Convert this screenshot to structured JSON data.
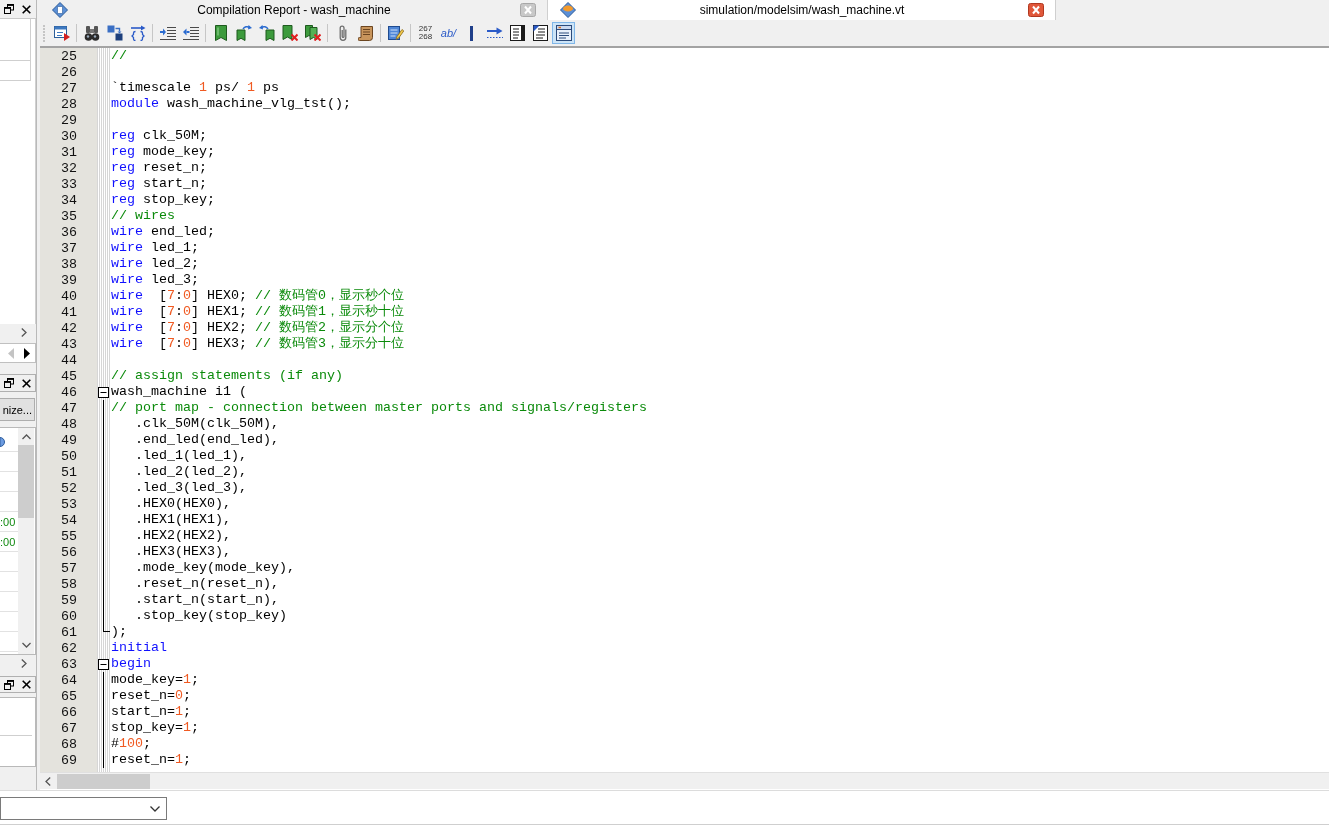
{
  "left_panel": {
    "navigator": [
      {
        "kind": "back",
        "disabled": true
      },
      {
        "kind": "forward",
        "disabled": false
      }
    ],
    "button": {
      "label": "nize..."
    },
    "table_rows": [
      {
        "kind": "icon"
      },
      {
        "kind": "blank"
      },
      {
        "kind": "blank"
      },
      {
        "kind": "blank"
      },
      {
        "kind": "time",
        "text": ":00"
      },
      {
        "kind": "time",
        "text": ":00"
      },
      {
        "kind": "blank"
      },
      {
        "kind": "blank"
      },
      {
        "kind": "blank"
      },
      {
        "kind": "blank"
      },
      {
        "kind": "blank"
      }
    ]
  },
  "tabs": [
    {
      "kind": "report",
      "title": "Compilation Report - wash_machine",
      "selected": false
    },
    {
      "kind": "source",
      "title": "simulation/modelsim/wash_machine.vt",
      "selected": true
    }
  ],
  "toolbar": [
    {
      "buttons": [
        {
          "kind": "report",
          "selected": false
        }
      ]
    },
    {
      "buttons": [
        {
          "kind": "find",
          "selected": false
        },
        {
          "kind": "replace",
          "selected": false
        },
        {
          "kind": "braces",
          "selected": false
        }
      ]
    },
    {
      "buttons": [
        {
          "kind": "indent",
          "selected": false
        },
        {
          "kind": "outdent",
          "selected": false
        }
      ]
    },
    {
      "buttons": [
        {
          "kind": "bookmark",
          "selected": false
        },
        {
          "kind": "nextmark",
          "selected": false
        },
        {
          "kind": "prevmark",
          "selected": false
        },
        {
          "kind": "unmark",
          "selected": false
        },
        {
          "kind": "unmarkall",
          "selected": false
        }
      ]
    },
    {
      "buttons": [
        {
          "kind": "attach",
          "selected": false
        },
        {
          "kind": "scroll",
          "selected": false
        }
      ]
    },
    {
      "buttons": [
        {
          "kind": "edit",
          "selected": false
        }
      ]
    },
    {
      "buttons": [
        {
          "kind": "numbers",
          "lines": [
            "267",
            "268"
          ],
          "selected": false
        },
        {
          "kind": "label",
          "text": "ab/",
          "selected": false
        },
        {
          "kind": "bar",
          "selected": false
        },
        {
          "kind": "arrow",
          "selected": false
        },
        {
          "kind": "doc",
          "selected": false
        },
        {
          "kind": "docmark",
          "selected": false
        },
        {
          "kind": "panel",
          "selected": true
        }
      ]
    }
  ],
  "editor": {
    "lines": [
      {
        "number": "25",
        "tokens": [
          {
            "kind": "comment",
            "text": "//"
          }
        ]
      },
      {
        "number": "26"
      },
      {
        "number": "27",
        "tokens": [
          {
            "kind": "plain",
            "text": "`timescale "
          },
          {
            "kind": "number",
            "text": "1"
          },
          {
            "kind": "plain",
            "text": " ps/ "
          },
          {
            "kind": "number",
            "text": "1"
          },
          {
            "kind": "plain",
            "text": " ps"
          }
        ]
      },
      {
        "number": "28",
        "tokens": [
          {
            "kind": "keyword",
            "text": "module"
          },
          {
            "kind": "plain",
            "text": " wash_machine_vlg_tst();"
          }
        ]
      },
      {
        "number": "29"
      },
      {
        "number": "30",
        "tokens": [
          {
            "kind": "keyword",
            "text": "reg"
          },
          {
            "kind": "plain",
            "text": " clk_50M;"
          }
        ]
      },
      {
        "number": "31",
        "tokens": [
          {
            "kind": "keyword",
            "text": "reg"
          },
          {
            "kind": "plain",
            "text": " mode_key;"
          }
        ]
      },
      {
        "number": "32",
        "tokens": [
          {
            "kind": "keyword",
            "text": "reg"
          },
          {
            "kind": "plain",
            "text": " reset_n;"
          }
        ]
      },
      {
        "number": "33",
        "tokens": [
          {
            "kind": "keyword",
            "text": "reg"
          },
          {
            "kind": "plain",
            "text": " start_n;"
          }
        ]
      },
      {
        "number": "34",
        "tokens": [
          {
            "kind": "keyword",
            "text": "reg"
          },
          {
            "kind": "plain",
            "text": " stop_key;"
          }
        ]
      },
      {
        "number": "35",
        "tokens": [
          {
            "kind": "comment",
            "text": "// wires"
          }
        ]
      },
      {
        "number": "36",
        "tokens": [
          {
            "kind": "keyword",
            "text": "wire"
          },
          {
            "kind": "plain",
            "text": " end_led;"
          }
        ]
      },
      {
        "number": "37",
        "tokens": [
          {
            "kind": "keyword",
            "text": "wire"
          },
          {
            "kind": "plain",
            "text": " led_1;"
          }
        ]
      },
      {
        "number": "38",
        "tokens": [
          {
            "kind": "keyword",
            "text": "wire"
          },
          {
            "kind": "plain",
            "text": " led_2;"
          }
        ]
      },
      {
        "number": "39",
        "tokens": [
          {
            "kind": "keyword",
            "text": "wire"
          },
          {
            "kind": "plain",
            "text": " led_3;"
          }
        ]
      },
      {
        "number": "40",
        "tokens": [
          {
            "kind": "keyword",
            "text": "wire"
          },
          {
            "kind": "plain",
            "text": "  ["
          },
          {
            "kind": "number",
            "text": "7"
          },
          {
            "kind": "plain",
            "text": ":"
          },
          {
            "kind": "number",
            "text": "0"
          },
          {
            "kind": "plain",
            "text": "] HEX0; "
          },
          {
            "kind": "comment",
            "text": "// 数码管0，显示秒个位"
          }
        ]
      },
      {
        "number": "41",
        "tokens": [
          {
            "kind": "keyword",
            "text": "wire"
          },
          {
            "kind": "plain",
            "text": "  ["
          },
          {
            "kind": "number",
            "text": "7"
          },
          {
            "kind": "plain",
            "text": ":"
          },
          {
            "kind": "number",
            "text": "0"
          },
          {
            "kind": "plain",
            "text": "] HEX1; "
          },
          {
            "kind": "comment",
            "text": "// 数码管1，显示秒十位"
          }
        ]
      },
      {
        "number": "42",
        "tokens": [
          {
            "kind": "keyword",
            "text": "wire"
          },
          {
            "kind": "plain",
            "text": "  ["
          },
          {
            "kind": "number",
            "text": "7"
          },
          {
            "kind": "plain",
            "text": ":"
          },
          {
            "kind": "number",
            "text": "0"
          },
          {
            "kind": "plain",
            "text": "] HEX2; "
          },
          {
            "kind": "comment",
            "text": "// 数码管2，显示分个位"
          }
        ]
      },
      {
        "number": "43",
        "tokens": [
          {
            "kind": "keyword",
            "text": "wire"
          },
          {
            "kind": "plain",
            "text": "  ["
          },
          {
            "kind": "number",
            "text": "7"
          },
          {
            "kind": "plain",
            "text": ":"
          },
          {
            "kind": "number",
            "text": "0"
          },
          {
            "kind": "plain",
            "text": "] HEX3; "
          },
          {
            "kind": "comment",
            "text": "// 数码管3，显示分十位"
          }
        ]
      },
      {
        "number": "44"
      },
      {
        "number": "45",
        "tokens": [
          {
            "kind": "comment",
            "text": "// assign statements (if any)"
          }
        ]
      },
      {
        "number": "46",
        "tokens": [
          {
            "kind": "plain",
            "text": "wash_machine i1 ("
          }
        ],
        "expanded": true,
        "block_end_visible": true,
        "children": [
          {
            "number": "47",
            "tokens": [
              {
                "kind": "comment",
                "text": "// port map - connection between master ports and signals/registers"
              }
            ]
          },
          {
            "number": "48",
            "tokens": [
              {
                "kind": "plain",
                "text": "   .clk_50M(clk_50M),"
              }
            ]
          },
          {
            "number": "49",
            "tokens": [
              {
                "kind": "plain",
                "text": "   .end_led(end_led),"
              }
            ]
          },
          {
            "number": "50",
            "tokens": [
              {
                "kind": "plain",
                "text": "   .led_1(led_1),"
              }
            ]
          },
          {
            "number": "51",
            "tokens": [
              {
                "kind": "plain",
                "text": "   .led_2(led_2),"
              }
            ]
          },
          {
            "number": "52",
            "tokens": [
              {
                "kind": "plain",
                "text": "   .led_3(led_3),"
              }
            ]
          },
          {
            "number": "53",
            "tokens": [
              {
                "kind": "plain",
                "text": "   .HEX0(HEX0),"
              }
            ]
          },
          {
            "number": "54",
            "tokens": [
              {
                "kind": "plain",
                "text": "   .HEX1(HEX1),"
              }
            ]
          },
          {
            "number": "55",
            "tokens": [
              {
                "kind": "plain",
                "text": "   .HEX2(HEX2),"
              }
            ]
          },
          {
            "number": "56",
            "tokens": [
              {
                "kind": "plain",
                "text": "   .HEX3(HEX3),"
              }
            ]
          },
          {
            "number": "57",
            "tokens": [
              {
                "kind": "plain",
                "text": "   .mode_key(mode_key),"
              }
            ]
          },
          {
            "number": "58",
            "tokens": [
              {
                "kind": "plain",
                "text": "   .reset_n(reset_n),"
              }
            ]
          },
          {
            "number": "59",
            "tokens": [
              {
                "kind": "plain",
                "text": "   .start_n(start_n),"
              }
            ]
          },
          {
            "number": "60",
            "tokens": [
              {
                "kind": "plain",
                "text": "   .stop_key(stop_key)"
              }
            ]
          },
          {
            "number": "61",
            "tokens": [
              {
                "kind": "plain",
                "text": ");"
              }
            ]
          }
        ]
      },
      {
        "number": "62",
        "tokens": [
          {
            "kind": "keyword",
            "text": "initial"
          }
        ]
      },
      {
        "number": "63",
        "tokens": [
          {
            "kind": "keyword",
            "text": "begin"
          }
        ],
        "expanded": true,
        "block_end_visible": false,
        "children": [
          {
            "number": "64",
            "tokens": [
              {
                "kind": "plain",
                "text": "mode_key="
              },
              {
                "kind": "number",
                "text": "1"
              },
              {
                "kind": "plain",
                "text": ";"
              }
            ]
          },
          {
            "number": "65",
            "tokens": [
              {
                "kind": "plain",
                "text": "reset_n="
              },
              {
                "kind": "number",
                "text": "0"
              },
              {
                "kind": "plain",
                "text": ";"
              }
            ]
          },
          {
            "number": "66",
            "tokens": [
              {
                "kind": "plain",
                "text": "start_n="
              },
              {
                "kind": "number",
                "text": "1"
              },
              {
                "kind": "plain",
                "text": ";"
              }
            ]
          },
          {
            "number": "67",
            "tokens": [
              {
                "kind": "plain",
                "text": "stop_key="
              },
              {
                "kind": "number",
                "text": "1"
              },
              {
                "kind": "plain",
                "text": ";"
              }
            ]
          },
          {
            "number": "68",
            "tokens": [
              {
                "kind": "plain",
                "text": "#"
              },
              {
                "kind": "number",
                "text": "100"
              },
              {
                "kind": "plain",
                "text": ";"
              }
            ]
          },
          {
            "number": "69",
            "tokens": [
              {
                "kind": "plain",
                "text": "reset_n="
              },
              {
                "kind": "number",
                "text": "1"
              },
              {
                "kind": "plain",
                "text": ";"
              }
            ]
          }
        ]
      }
    ]
  }
}
